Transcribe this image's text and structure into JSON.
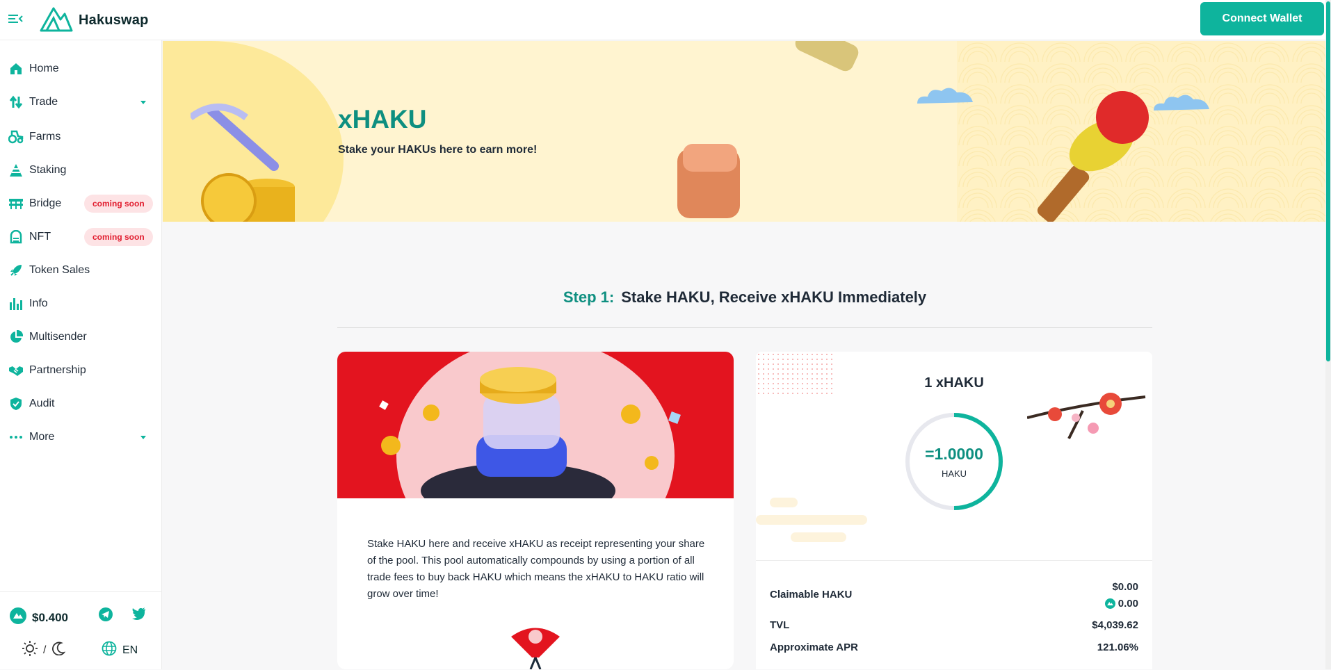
{
  "header": {
    "logo_text": "Hakuswap",
    "connect_label": "Connect Wallet"
  },
  "sidebar": {
    "items": [
      {
        "label": "Home",
        "icon": "home-icon"
      },
      {
        "label": "Trade",
        "icon": "trade-icon"
      },
      {
        "label": "Farms",
        "icon": "tractor-icon"
      },
      {
        "label": "Staking",
        "icon": "pyramid-icon"
      },
      {
        "label": "Bridge",
        "icon": "bridge-icon",
        "badge": "coming soon"
      },
      {
        "label": "NFT",
        "icon": "nft-icon",
        "badge": "coming soon"
      },
      {
        "label": "Token Sales",
        "icon": "rocket-icon"
      },
      {
        "label": "Info",
        "icon": "bar-chart-icon"
      },
      {
        "label": "Multisender",
        "icon": "pie-chart-icon"
      },
      {
        "label": "Partnership",
        "icon": "handshake-icon"
      },
      {
        "label": "Audit",
        "icon": "shield-check-icon"
      },
      {
        "label": "More",
        "icon": "dots-icon"
      }
    ],
    "price": "$0.400",
    "theme_separator": "/",
    "language": "EN"
  },
  "hero": {
    "title": "xHAKU",
    "subtitle": "Stake your HAKUs here to earn more!"
  },
  "step": {
    "prefix": "Step 1:",
    "title": "Stake HAKU, Receive xHAKU Immediately"
  },
  "stake_card": {
    "description": "Stake HAKU here and receive xHAKU as receipt representing your share of the pool. This pool automatically compounds by using a portion of all trade fees to buy back HAKU which means the xHAKU to HAKU ratio will grow over time!"
  },
  "ratio_card": {
    "title": "1 xHAKU",
    "value": "=1.0000",
    "unit": "HAKU",
    "ring_fraction": 0.5
  },
  "stats": {
    "claimable_label": "Claimable HAKU",
    "claimable_usd": "$0.00",
    "claimable_amount": "0.00",
    "tvl_label": "TVL",
    "tvl_value": "$4,039.62",
    "apr_label": "Approximate APR",
    "apr_value": "121.06%"
  },
  "colors": {
    "accent": "#0eb49d",
    "accent_dark": "#0e8f80",
    "badge_bg": "#fde3e5",
    "badge_text": "#e11d2f",
    "card_red": "#e3141f",
    "hero_bg": "#fff4d0"
  }
}
